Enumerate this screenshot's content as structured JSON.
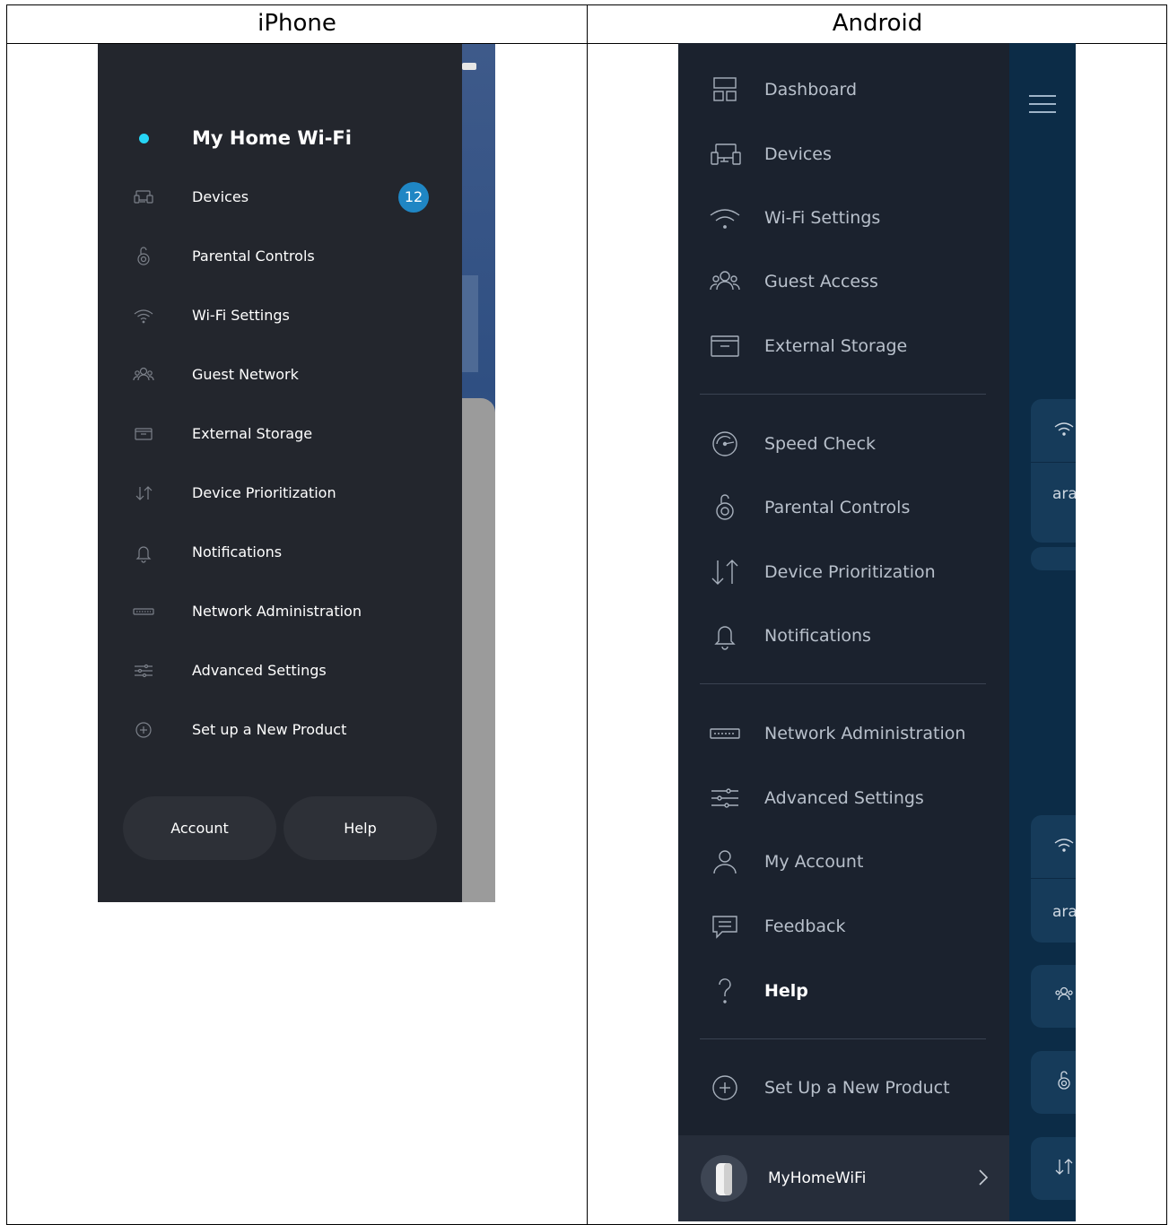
{
  "table": {
    "headers": [
      "iPhone",
      "Android"
    ]
  },
  "iphone": {
    "network_name": "My Home Wi-Fi",
    "items": [
      {
        "label": "Devices",
        "icon": "devices-icon",
        "badge": "12"
      },
      {
        "label": "Parental Controls",
        "icon": "parental-controls-icon"
      },
      {
        "label": "Wi-Fi Settings",
        "icon": "wifi-icon"
      },
      {
        "label": "Guest Network",
        "icon": "guest-icon"
      },
      {
        "label": "External Storage",
        "icon": "storage-icon"
      },
      {
        "label": "Device Prioritization",
        "icon": "prioritization-icon"
      },
      {
        "label": "Notifications",
        "icon": "bell-icon"
      },
      {
        "label": "Network Administration",
        "icon": "router-icon"
      },
      {
        "label": "Advanced Settings",
        "icon": "sliders-icon"
      },
      {
        "label": "Set up a New Product",
        "icon": "plus-circle-icon"
      }
    ],
    "buttons": {
      "account": "Account",
      "help": "Help"
    },
    "colors": {
      "panel": "#23262d",
      "accent_dot": "#26d5f5",
      "badge": "#1f86c4"
    }
  },
  "android": {
    "items": [
      {
        "label": "Dashboard",
        "icon": "dashboard-icon"
      },
      {
        "label": "Devices",
        "icon": "devices-icon"
      },
      {
        "label": "Wi-Fi Settings",
        "icon": "wifi-icon"
      },
      {
        "label": "Guest Access",
        "icon": "guest-icon"
      },
      {
        "label": "External Storage",
        "icon": "storage-icon"
      },
      {
        "label": "Speed Check",
        "icon": "speedometer-icon"
      },
      {
        "label": "Parental Controls",
        "icon": "parental-controls-icon"
      },
      {
        "label": "Device Prioritization",
        "icon": "prioritization-icon"
      },
      {
        "label": "Notifications",
        "icon": "bell-icon"
      },
      {
        "label": "Network Administration",
        "icon": "router-icon"
      },
      {
        "label": "Advanced Settings",
        "icon": "sliders-icon"
      },
      {
        "label": "My Account",
        "icon": "user-icon"
      },
      {
        "label": "Feedback",
        "icon": "feedback-icon"
      },
      {
        "label": "Help",
        "icon": "question-icon"
      },
      {
        "label": "Set Up a New Product",
        "icon": "plus-circle-icon"
      }
    ],
    "footer": {
      "name": "MyHomeWiFi"
    },
    "background_cards": {
      "text": "ara"
    },
    "colors": {
      "panel": "#1b222e",
      "background": "#0c2c47"
    }
  }
}
